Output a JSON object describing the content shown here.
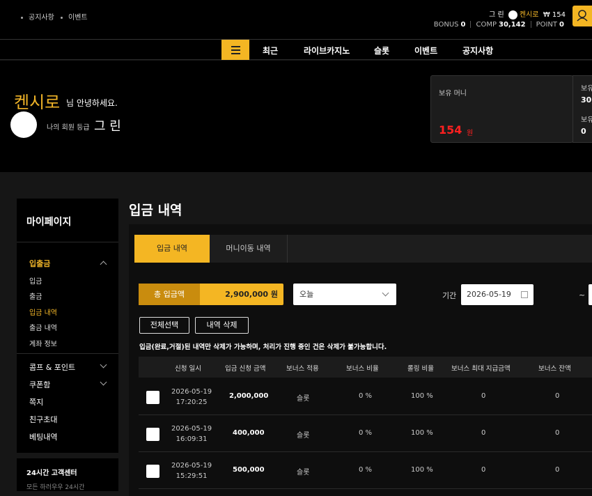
{
  "topbar": {
    "links": [
      "공지사항",
      "이벤트"
    ],
    "user_grade": "그 린",
    "user_nick": "켄시로",
    "balance": "₩ 154",
    "bonus_label": "BONUS",
    "bonus_value": "0",
    "comp_label": "COMP",
    "comp_value": "30,142",
    "point_label": "POINT",
    "point_value": "0"
  },
  "nav": {
    "items": [
      "최근",
      "라이브카지노",
      "슬롯",
      "이벤트",
      "공지사항"
    ]
  },
  "hero": {
    "nickname": "켄시로",
    "greeting": "님 안녕하세요.",
    "level_label": "나의 회원 등급",
    "level": "그 린",
    "money_label": "보유 머니",
    "money_value": "154",
    "money_unit": "원",
    "card2_label1": "보유",
    "card2_value1": "30,",
    "card2_label2": "보유",
    "card2_value2": "0"
  },
  "sidebar": {
    "title": "마이페이지",
    "section1": "입출금",
    "sub": [
      "입금",
      "출금",
      "입금 내역",
      "출금 내역",
      "계좌 정보"
    ],
    "menu": [
      "콤프 & 포인트",
      "쿠폰함",
      "쪽지",
      "친구초대",
      "베팅내역"
    ],
    "support": "24시간 고객센터",
    "support_sub": "모든 하러우우 24시간"
  },
  "page": {
    "title": "입금 내역"
  },
  "tabs": [
    "입금 내역",
    "머니이동 내역"
  ],
  "filter": {
    "total_label": "총 입금액",
    "total_value": "2,900,000 원",
    "range_select": "오늘",
    "period_label": "기간",
    "date_from": "2026-05-19",
    "tilde": "~"
  },
  "buttons": {
    "select_all": "전체선택",
    "delete": "내역 삭제"
  },
  "notice": "입금(완료,거절)된 내역만 삭제가 가능하며, 처리가 진행 중인 건은 삭제가 불가능합니다.",
  "table": {
    "headers": [
      "신청 일시",
      "입금 신청 금액",
      "보너스 적용",
      "보너스 비율",
      "롤링 비율",
      "보너스 최대 지급금액",
      "보너스 잔액"
    ],
    "rows": [
      {
        "date": "2026-05-19",
        "time": "17:20:25",
        "amount": "2,000,000",
        "bonus": "슬롯",
        "ratio": "0 %",
        "rolling": "100 %",
        "max": "0",
        "remain": "0"
      },
      {
        "date": "2026-05-19",
        "time": "16:09:31",
        "amount": "400,000",
        "bonus": "슬롯",
        "ratio": "0 %",
        "rolling": "100 %",
        "max": "0",
        "remain": "0"
      },
      {
        "date": "2026-05-19",
        "time": "15:29:51",
        "amount": "500,000",
        "bonus": "슬롯",
        "ratio": "0 %",
        "rolling": "100 %",
        "max": "0",
        "remain": "0"
      }
    ]
  },
  "colors": {
    "accent": "#f4b623",
    "accent_dark": "#c98c0e",
    "money": "#ff2020"
  }
}
